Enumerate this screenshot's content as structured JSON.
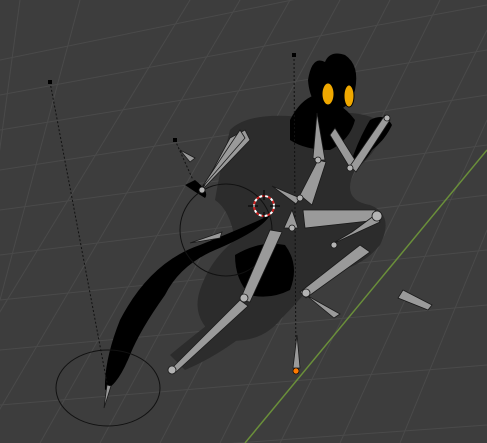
{
  "app": "3D Viewport",
  "colors": {
    "background": "#3d3d3d",
    "grid": "#4a4a4a",
    "axis_y": "#6a8f3a",
    "mesh_shadow": "#2c2c2c",
    "mesh_body": "#000000",
    "bone": "#9a9a9a",
    "joint": "#b3b3b3",
    "eye": "#f0a800",
    "cursor_red": "#d02020",
    "origin_dot": "#ff7a00"
  },
  "icons": {
    "cursor": "3d-cursor-icon",
    "origin": "object-origin-icon"
  }
}
